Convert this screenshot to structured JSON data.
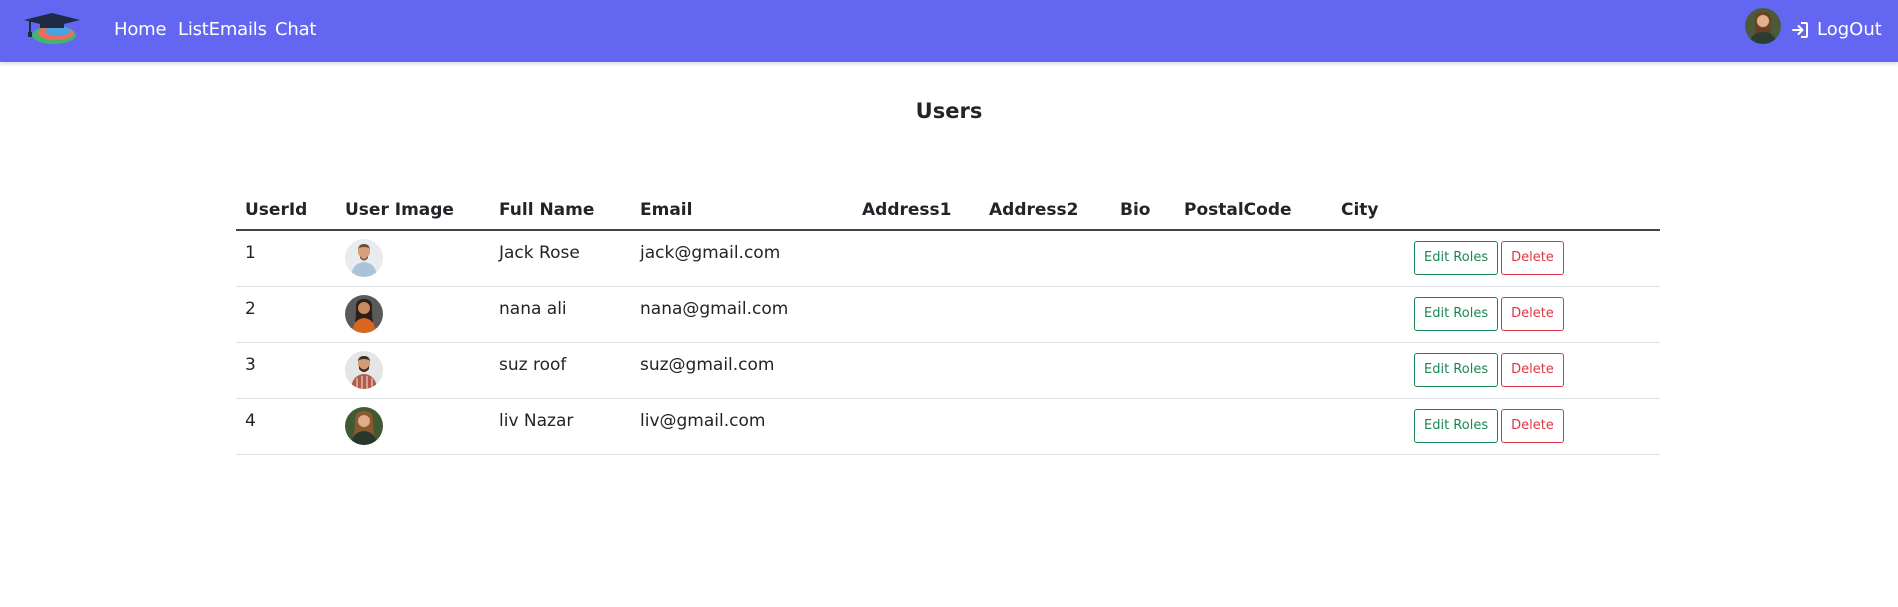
{
  "colors": {
    "accent": "#6366f1",
    "success": "#198754",
    "danger": "#dc3545"
  },
  "nav": {
    "logo_icon": "graduation-cap-logo",
    "links": [
      "Home",
      "ListEmails",
      "Chat"
    ],
    "logout_label": "LogOut",
    "logout_icon": "sign-in-arrow-icon"
  },
  "page": {
    "title": "Users"
  },
  "table": {
    "headers": [
      "UserId",
      "User Image",
      "Full Name",
      "Email",
      "Address1",
      "Address2",
      "Bio",
      "PostalCode",
      "City",
      ""
    ],
    "rows": [
      {
        "id": "1",
        "image": "avatar-man-light-shirt",
        "name": "Jack Rose",
        "email": "jack@gmail.com",
        "address1": "",
        "address2": "",
        "bio": "",
        "postal": "",
        "city": "",
        "edit_label": "Edit Roles",
        "delete_label": "Delete"
      },
      {
        "id": "2",
        "image": "avatar-woman-orange-top",
        "name": "nana ali",
        "email": "nana@gmail.com",
        "address1": "",
        "address2": "",
        "bio": "",
        "postal": "",
        "city": "",
        "edit_label": "Edit Roles",
        "delete_label": "Delete"
      },
      {
        "id": "3",
        "image": "avatar-man-plaid-shirt",
        "name": "suz roof",
        "email": "suz@gmail.com",
        "address1": "",
        "address2": "",
        "bio": "",
        "postal": "",
        "city": "",
        "edit_label": "Edit Roles",
        "delete_label": "Delete"
      },
      {
        "id": "4",
        "image": "avatar-woman-green-background",
        "name": "liv Nazar",
        "email": "liv@gmail.com",
        "address1": "",
        "address2": "",
        "bio": "",
        "postal": "",
        "city": "",
        "edit_label": "Edit Roles",
        "delete_label": "Delete"
      }
    ]
  }
}
